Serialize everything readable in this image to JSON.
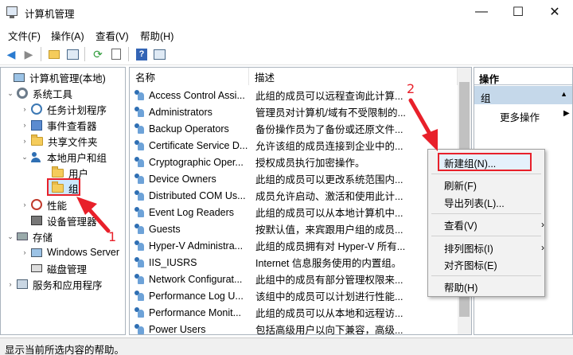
{
  "window": {
    "title": "计算机管理",
    "minimize_glyph": "—",
    "maximize_glyph": "☐",
    "close_glyph": "✕"
  },
  "menubar": [
    "文件(F)",
    "操作(A)",
    "查看(V)",
    "帮助(H)"
  ],
  "toolbar": {
    "buttons": [
      "back-icon",
      "forward-icon",
      "up-folder-icon",
      "show-hide-tree-icon",
      "refresh-icon",
      "export-list-icon",
      "help-icon",
      "show-hide-action-pane-icon"
    ]
  },
  "tree": {
    "items": [
      {
        "label": "计算机管理(本地)",
        "icon": "computer-icon"
      },
      {
        "label": "系统工具",
        "icon": "tools-icon"
      },
      {
        "label": "任务计划程序",
        "icon": "clock-icon"
      },
      {
        "label": "事件查看器",
        "icon": "event-viewer-icon"
      },
      {
        "label": "共享文件夹",
        "icon": "shared-folder-icon"
      },
      {
        "label": "本地用户和组",
        "icon": "users-icon"
      },
      {
        "label": "用户",
        "icon": "folder-icon"
      },
      {
        "label": "组",
        "icon": "folder-icon",
        "selected": true
      },
      {
        "label": "性能",
        "icon": "performance-icon"
      },
      {
        "label": "设备管理器",
        "icon": "device-manager-icon"
      },
      {
        "label": "存储",
        "icon": "storage-icon"
      },
      {
        "label": "Windows Server",
        "icon": "backup-icon"
      },
      {
        "label": "磁盘管理",
        "icon": "disk-icon"
      },
      {
        "label": "服务和应用程序",
        "icon": "services-icon"
      }
    ]
  },
  "list": {
    "columns": [
      "名称",
      "描述"
    ],
    "rows": [
      {
        "name": "Access Control Assi...",
        "desc": "此组的成员可以远程查询此计算..."
      },
      {
        "name": "Administrators",
        "desc": "管理员对计算机/域有不受限制的..."
      },
      {
        "name": "Backup Operators",
        "desc": "备份操作员为了备份或还原文件..."
      },
      {
        "name": "Certificate Service D...",
        "desc": "允许该组的成员连接到企业中的..."
      },
      {
        "name": "Cryptographic Oper...",
        "desc": "授权成员执行加密操作。"
      },
      {
        "name": "Device Owners",
        "desc": "此组的成员可以更改系统范围内..."
      },
      {
        "name": "Distributed COM Us...",
        "desc": "成员允许启动、激活和使用此计..."
      },
      {
        "name": "Event Log Readers",
        "desc": "此组的成员可以从本地计算机中..."
      },
      {
        "name": "Guests",
        "desc": "按默认值，来宾跟用户组的成员..."
      },
      {
        "name": "Hyper-V Administra...",
        "desc": "此组的成员拥有对 Hyper-V 所有..."
      },
      {
        "name": "IIS_IUSRS",
        "desc": "Internet 信息服务使用的内置组。"
      },
      {
        "name": "Network Configurat...",
        "desc": "此组中的成员有部分管理权限来..."
      },
      {
        "name": "Performance Log U...",
        "desc": "该组中的成员可以计划进行性能..."
      },
      {
        "name": "Performance Monit...",
        "desc": "此组的成员可以从本地和远程访..."
      },
      {
        "name": "Power Users",
        "desc": "包括高级用户以向下兼容，高级..."
      }
    ]
  },
  "actions": {
    "header": "操作",
    "group": "组",
    "more": "更多操作"
  },
  "context_menu": {
    "items": [
      {
        "label": "新建组(N)...",
        "highlighted": true
      },
      {
        "label": "刷新(F)"
      },
      {
        "label": "导出列表(L)..."
      },
      {
        "label": "查看(V)",
        "submenu": true
      },
      {
        "label": "排列图标(I)",
        "submenu": true
      },
      {
        "label": "对齐图标(E)"
      },
      {
        "label": "帮助(H)"
      }
    ],
    "submenu_glyph": "›"
  },
  "annotations": {
    "step1": "1",
    "step2": "2",
    "color": "#e8202a"
  },
  "statusbar": {
    "text": "显示当前所选内容的帮助。"
  }
}
